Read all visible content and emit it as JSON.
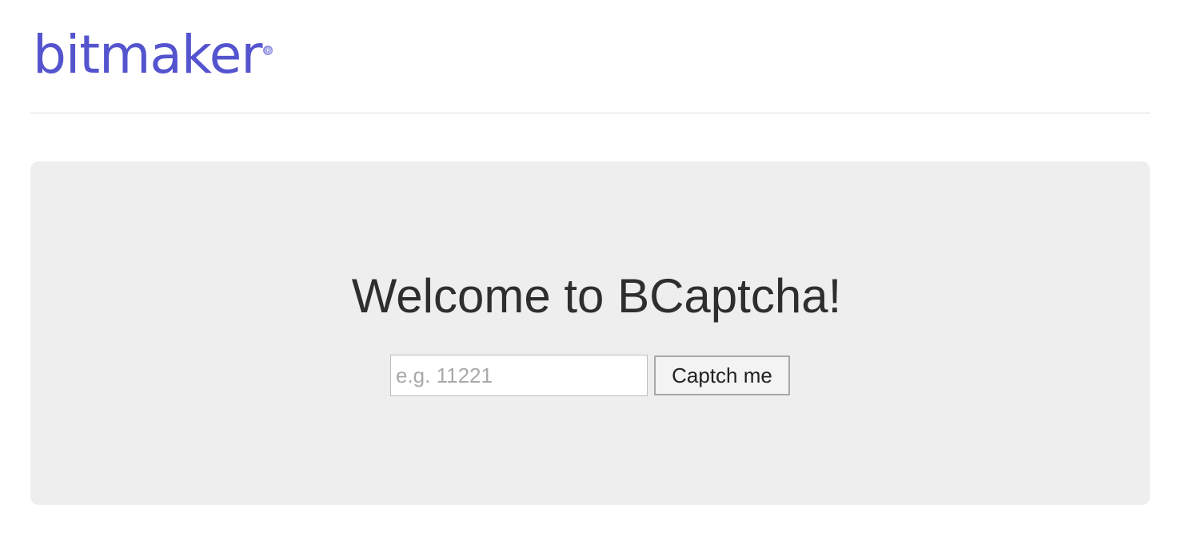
{
  "header": {
    "logo_text": "bitmaker",
    "logo_mark": "®",
    "brand_color": "#5454cf"
  },
  "main": {
    "title": "Welcome to BCaptcha!",
    "captcha_input": {
      "value": "",
      "placeholder": "e.g. 11221"
    },
    "submit_label": "Captch me",
    "panel_color": "#eeeeee"
  }
}
